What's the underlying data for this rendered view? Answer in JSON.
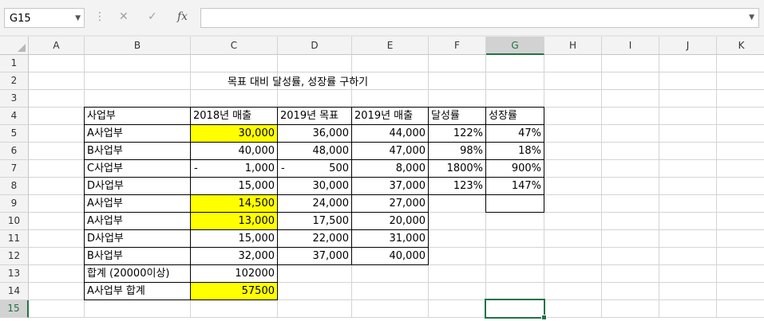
{
  "formula_bar": {
    "name_box": "G15",
    "cancel_glyph": "✕",
    "enter_glyph": "✓",
    "fx_glyph": "fx",
    "formula": ""
  },
  "columns": [
    "A",
    "B",
    "C",
    "D",
    "E",
    "F",
    "G",
    "H",
    "I",
    "J",
    "K"
  ],
  "active_column": "G",
  "active_row": "15",
  "rows": [
    "1",
    "2",
    "3",
    "4",
    "5",
    "6",
    "7",
    "8",
    "9",
    "10",
    "11",
    "12",
    "13",
    "14",
    "15"
  ],
  "title": "목표 대비 달성률, 성장률 구하기",
  "table": {
    "headers": [
      "사업부",
      "2018년 매출",
      "2019년 목표",
      "2019년 매출",
      "달성률",
      "성장률"
    ],
    "rows": [
      {
        "b": "A사업부",
        "c": "30,000",
        "d": "36,000",
        "e": "44,000",
        "f": "122%",
        "g": "47%"
      },
      {
        "b": "B사업부",
        "c": "40,000",
        "d": "48,000",
        "e": "47,000",
        "f": "98%",
        "g": "18%"
      },
      {
        "b": "C사업부",
        "c_dash": "-",
        "c": "1,000",
        "d_dash": "-",
        "d": "500",
        "e": "8,000",
        "f": "1800%",
        "g": "900%"
      },
      {
        "b": "D사업부",
        "c": "15,000",
        "d": "30,000",
        "e": "37,000",
        "f": "123%",
        "g": "147%"
      },
      {
        "b": "A사업부",
        "c": "14,500",
        "d": "24,000",
        "e": "27,000"
      },
      {
        "b": "A사업부",
        "c": "13,000",
        "d": "17,500",
        "e": "20,000"
      },
      {
        "b": "D사업부",
        "c": "15,000",
        "d": "22,000",
        "e": "31,000"
      },
      {
        "b": "B사업부",
        "c": "32,000",
        "d": "37,000",
        "e": "40,000"
      }
    ],
    "total_label": "합계 (20000이상)",
    "total_value": "102000",
    "a_total_label": "A사업부 합계",
    "a_total_value": "57500"
  },
  "colors": {
    "highlight": "#ffff00",
    "accent": "#217346"
  }
}
